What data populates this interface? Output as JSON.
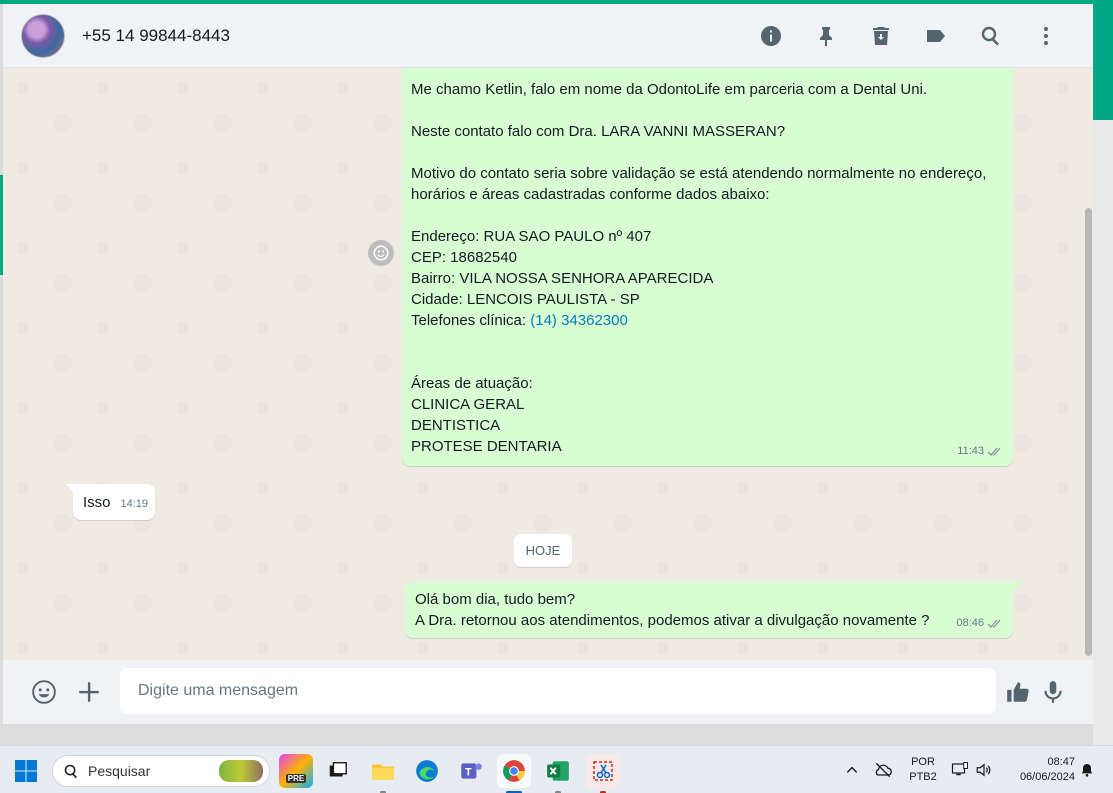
{
  "header": {
    "contact_name": "+55 14 99844-8443",
    "icons": [
      "info-icon",
      "pin-icon",
      "delete-icon",
      "label-icon",
      "search-icon",
      "menu-dots-icon"
    ]
  },
  "messages": {
    "m1": {
      "line1": "Me chamo Ketlin, falo em nome da OdontoLife em parceria com a Dental Uni.",
      "line2": "Neste contato falo com Dra. LARA VANNI MASSERAN?",
      "line3": "Motivo do contato seria sobre validação se está atendendo normalmente no endereço, horários e áreas cadastradas conforme dados abaixo:",
      "address": "Endereço: RUA SAO PAULO nº 407",
      "cep": "CEP: 18682540",
      "bairro": "Bairro: VILA NOSSA SENHORA APARECIDA",
      "cidade": "Cidade: LENCOIS PAULISTA - SP",
      "phone_label": "Telefones clínica: ",
      "phone_link": "(14) 34362300",
      "areas_title": "Áreas de atuação:",
      "area1": "CLINICA GERAL",
      "area2": "DENTISTICA",
      "area3": "PROTESE DENTARIA",
      "time": "11:43"
    },
    "m2": {
      "text": "Isso",
      "time": "14:19"
    },
    "date_chip": "HOJE",
    "m3": {
      "line1": "Olá bom dia, tudo bem?",
      "line2": "A Dra. retornou aos atendimentos, podemos ativar a divulgação novamente ?",
      "time": "08:46"
    }
  },
  "composer": {
    "placeholder": "Digite uma mensagem"
  },
  "taskbar": {
    "search_label": "Pesquisar",
    "copilot_badge": "PRE",
    "lang_line1": "POR",
    "lang_line2": "PTB2",
    "time": "08:47",
    "date": "06/06/2024"
  },
  "colors": {
    "outgoing_bubble": "#d9fdd3",
    "incoming_bubble": "#ffffff",
    "accent": "#00a884",
    "link": "#027eb5"
  }
}
